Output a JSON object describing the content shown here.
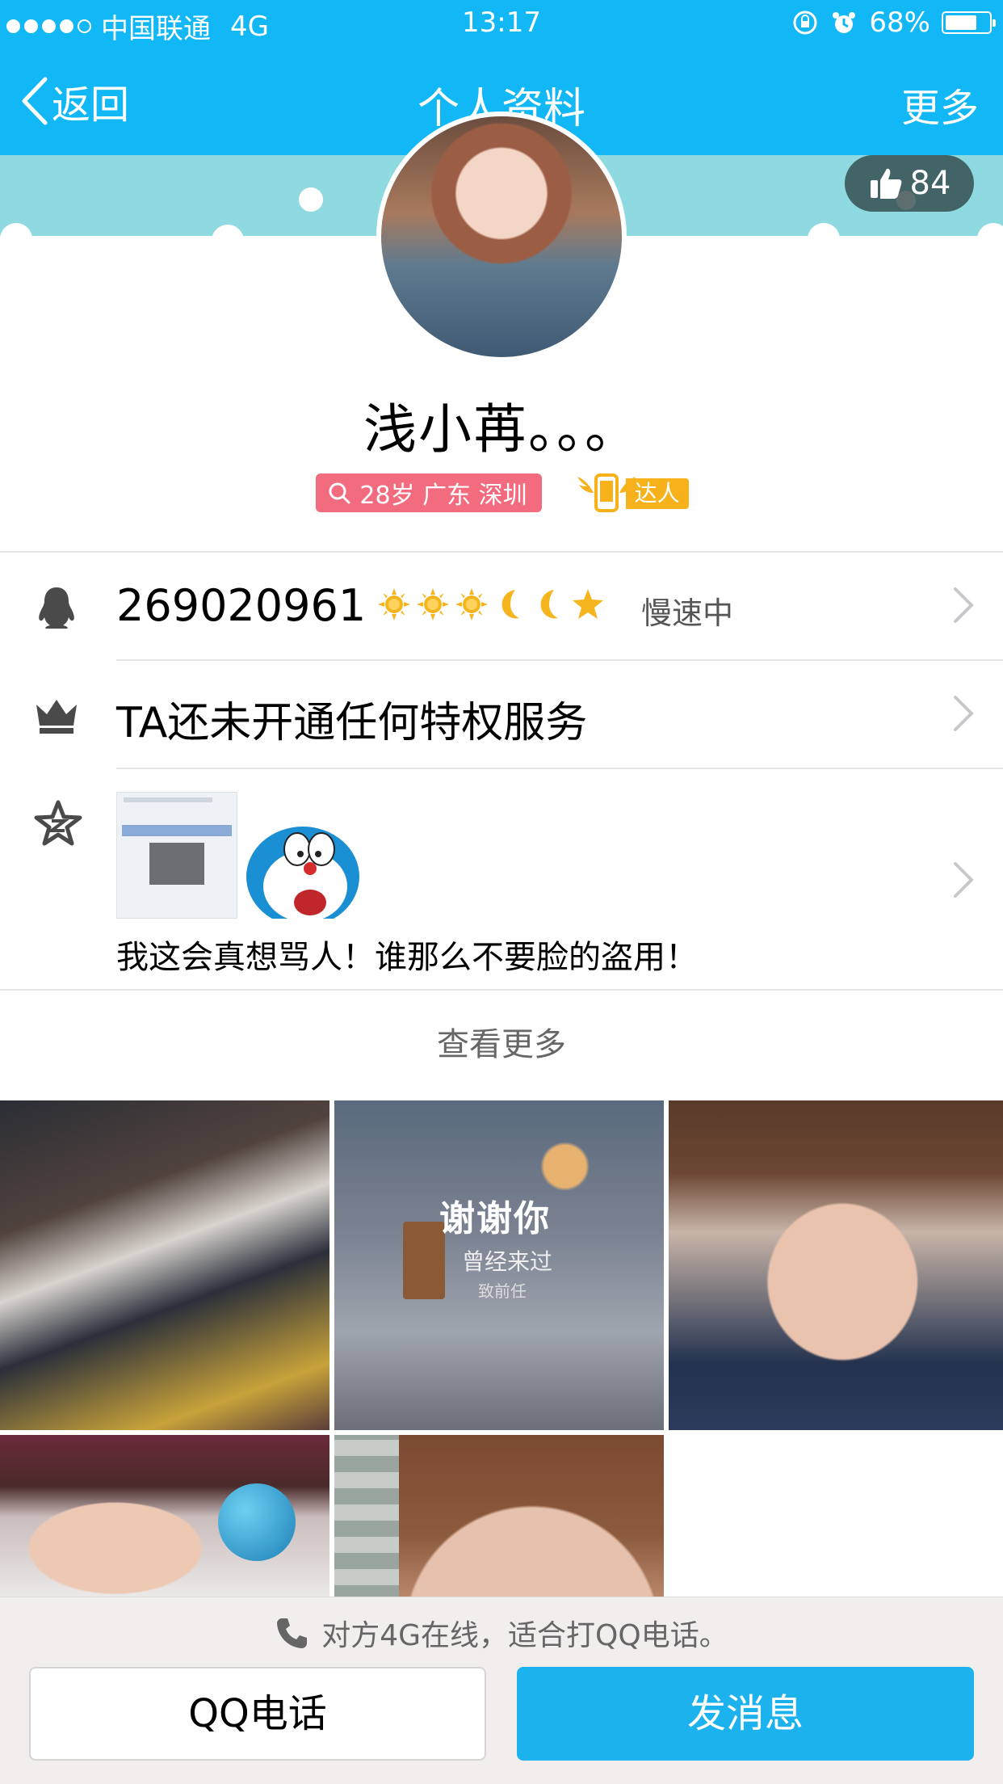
{
  "status_bar": {
    "carrier": "中国联通",
    "network": "4G",
    "time": "13:17",
    "battery": "68%"
  },
  "nav": {
    "back_label": "返回",
    "title": "个人资料",
    "more_label": "更多"
  },
  "profile": {
    "like_count": "84",
    "name": "浅小苒。。。",
    "location_tag": "28岁 广东 深圳",
    "talent_tag": "达人"
  },
  "qq_row": {
    "qq_number": "269020961",
    "level_icons": [
      "sun-icon",
      "sun-icon",
      "sun-icon",
      "moon-icon",
      "moon-icon",
      "star-icon"
    ],
    "speed_status": "慢速中"
  },
  "privilege_row": {
    "text": "TA还未开通任何特权服务"
  },
  "qzone_row": {
    "post_text": "我这会真想骂人！谁那么不要脸的盗用！"
  },
  "see_more_label": "查看更多",
  "photos": {
    "photo2_title": "谢谢你",
    "photo2_subtitle": "曾经来过",
    "photo2_caption": "致前任"
  },
  "bottom": {
    "call_hint": "对方4G在线，适合打QQ电话。",
    "call_button": "QQ电话",
    "message_button": "发消息"
  },
  "colors": {
    "header_blue": "#12b7f5",
    "banner_cyan": "#8fd9e1",
    "location_tag_pink": "#f36b7f",
    "talent_orange": "#f7b21b",
    "message_button_blue": "#1cb2ee"
  }
}
